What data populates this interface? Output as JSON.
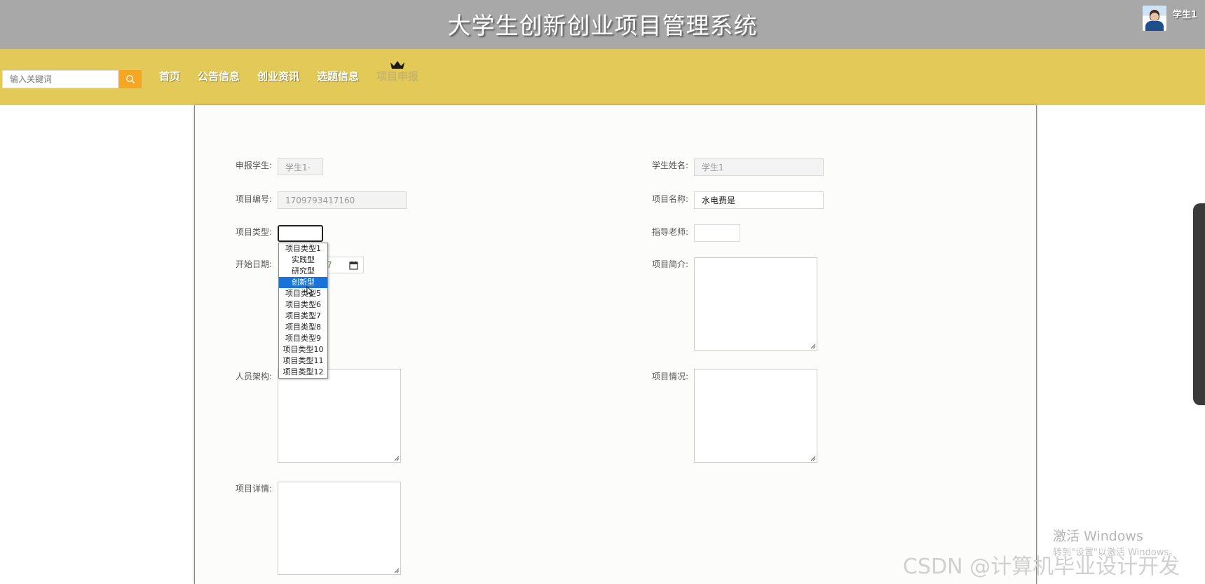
{
  "header": {
    "site_title": "大学生创新创业项目管理系统",
    "user_name": "学生1"
  },
  "nav": {
    "search_placeholder": "输入关键词",
    "items": [
      {
        "label": "首页"
      },
      {
        "label": "公告信息"
      },
      {
        "label": "创业资讯"
      },
      {
        "label": "选题信息"
      },
      {
        "label": "项目申报",
        "active": true
      }
    ]
  },
  "form": {
    "student_label": "申报学生:",
    "student_value": "学生1-",
    "student_name_label": "学生姓名:",
    "student_name_value": "学生1",
    "project_no_label": "项目编号:",
    "project_no_value": "1709793417160",
    "project_name_label": "项目名称:",
    "project_name_value": "水电费是",
    "project_type_label": "项目类型:",
    "project_type_value": "",
    "advisor_label": "指导老师:",
    "advisor_value": "",
    "start_date_label": "开始日期:",
    "start_date_partial": "7",
    "intro_label": "项目简介:",
    "staff_label": "人员架构:",
    "status_label": "项目情况:",
    "details_label": "项目详情:"
  },
  "project_type_options": [
    "项目类型1",
    "实践型",
    "研究型",
    "创新型",
    "项目类型5",
    "项目类型6",
    "项目类型7",
    "项目类型8",
    "项目类型9",
    "项目类型10",
    "项目类型11",
    "项目类型12"
  ],
  "highlighted_option_index": 3,
  "watermarks": {
    "windows_activate": "激活 Windows",
    "windows_activate_sub": "转到\"设置\"以激活 Windows。",
    "csdn": "CSDN @计算机毕业设计开发"
  },
  "colors": {
    "topbar": "#a8a8a8",
    "navbar": "#e3c958",
    "search_button": "#f5a623",
    "selected_option": "#1a73d9"
  }
}
